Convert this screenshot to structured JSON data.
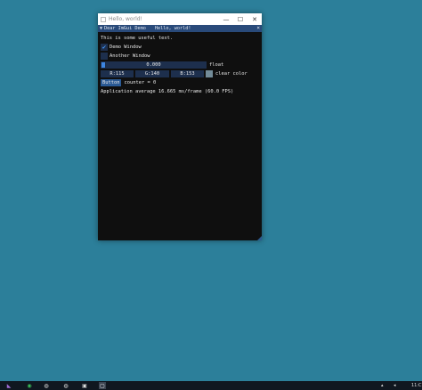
{
  "window": {
    "title": "Hello, world!",
    "minimize_glyph": "—",
    "maximize_glyph": "☐",
    "close_glyph": "✕"
  },
  "imgui": {
    "collapse_glyph": "▼",
    "tabs": [
      "Dear ImGui Demo",
      "Hello, world!"
    ],
    "close_glyph": "×",
    "text": "This is some useful text.",
    "checkboxes": [
      {
        "label": "Demo Window",
        "checked": true
      },
      {
        "label": "Another Window",
        "checked": false
      }
    ],
    "slider": {
      "value": "0.000",
      "label": "float",
      "fraction": 0.0
    },
    "color": {
      "r": "R:115",
      "g": "G:140",
      "b": "B:153",
      "label": "clear color",
      "swatch": "#738c99"
    },
    "button_label": "Button",
    "counter_text": "counter = 0",
    "fps_text": "Application average 16.665 ms/frame (60.0 FPS)"
  },
  "desktop": {
    "background": "#2c7f9a"
  },
  "taskbar": {
    "icons": [
      "visual-studio-icon",
      "app-green-icon",
      "unreal-icon",
      "unreal-icon-2",
      "window-icon",
      "window-active-icon"
    ],
    "clock": "11:C"
  }
}
